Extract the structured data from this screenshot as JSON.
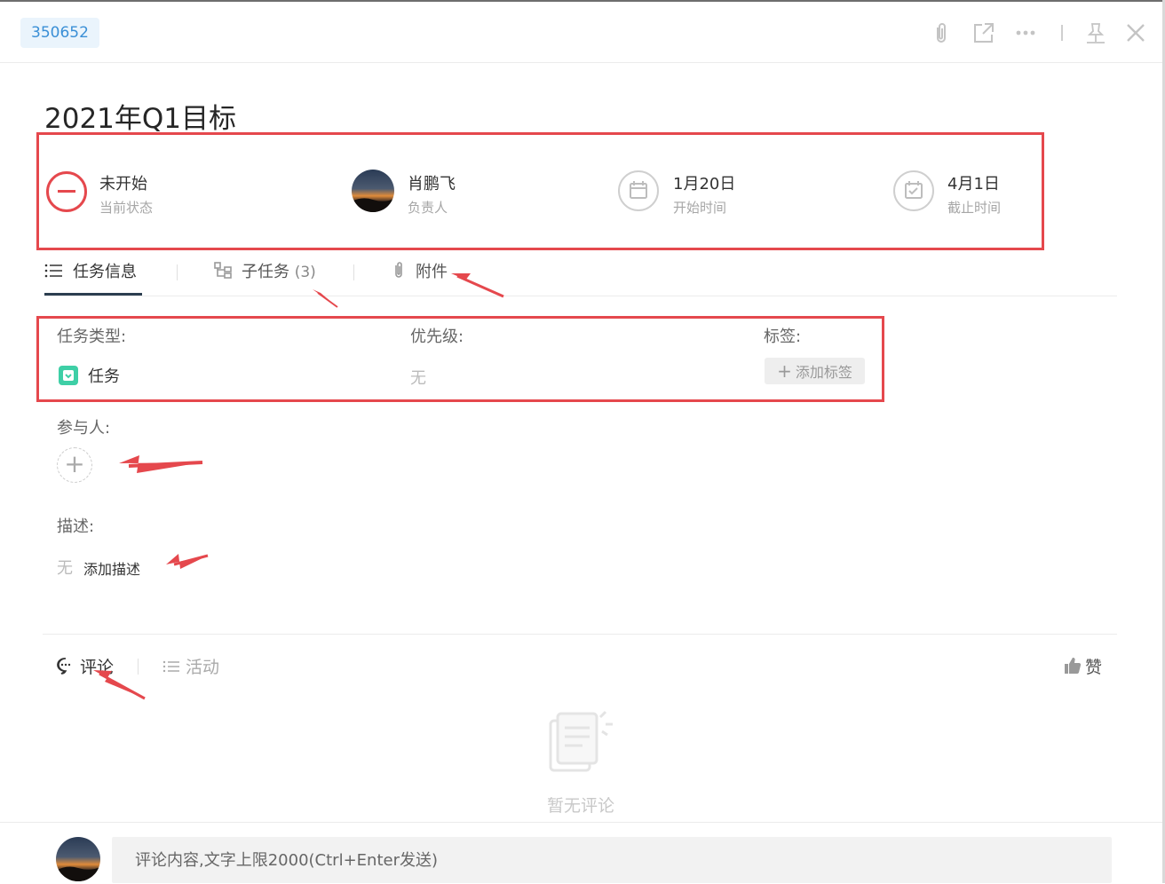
{
  "header": {
    "task_id": "350652",
    "icons": [
      "paperclip-icon",
      "external-link-icon",
      "more-icon",
      "pin-icon",
      "close-icon"
    ]
  },
  "task": {
    "title": "2021年Q1目标"
  },
  "meta": {
    "status": {
      "value": "未开始",
      "label": "当前状态",
      "icon": "minus-circle-icon"
    },
    "assignee": {
      "value": "肖鹏飞",
      "label": "负责人"
    },
    "start": {
      "value": "1月20日",
      "label": "开始时间",
      "icon": "calendar-icon"
    },
    "due": {
      "value": "4月1日",
      "label": "截止时间",
      "icon": "calendar-check-icon"
    }
  },
  "tabs": [
    {
      "label": "任务信息",
      "icon": "list-icon",
      "active": true
    },
    {
      "label": "子任务",
      "count": "(3)",
      "icon": "subtask-icon"
    },
    {
      "label": "附件",
      "icon": "paperclip-icon"
    }
  ],
  "fields": {
    "type_label": "任务类型:",
    "type_value": "任务",
    "priority_label": "优先级:",
    "priority_value": "无",
    "tags_label": "标签:",
    "add_tag": "添加标签",
    "participants_label": "参与人:",
    "description_label": "描述:",
    "description_value": "无",
    "add_description": "添加描述"
  },
  "comments": {
    "tab_comment": "评论",
    "tab_activity": "活动",
    "like": "赞",
    "empty": "暂无评论",
    "input_placeholder": "评论内容,文字上限2000(Ctrl+Enter发送)"
  },
  "colors": {
    "accent_blue": "#3a8fd6",
    "status_red": "#e5484d",
    "annotation_red": "#e5484d",
    "task_type_green": "#3ecfa6"
  }
}
